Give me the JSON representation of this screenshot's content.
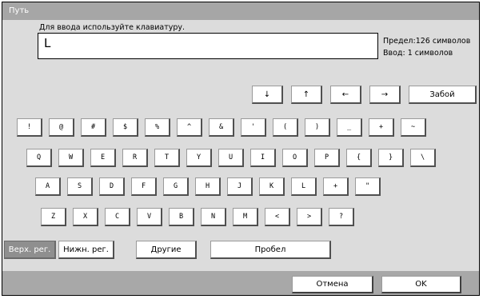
{
  "window": {
    "title": "Путь"
  },
  "prompt": {
    "instruction": "Для ввода используйте клавиатуру.",
    "value": "L"
  },
  "limits": {
    "max_label": "Предел:126 символов",
    "count_label": "Ввод: 1 символов"
  },
  "nav": {
    "down": "↓",
    "up": "↑",
    "left": "←",
    "right": "→",
    "backspace": "Забой"
  },
  "keys": {
    "row1": [
      "!",
      "@",
      "#",
      "$",
      "%",
      "^",
      "&",
      "'",
      "(",
      ")",
      "_",
      "+",
      "~"
    ],
    "row2": [
      "Q",
      "W",
      "E",
      "R",
      "T",
      "Y",
      "U",
      "I",
      "O",
      "P",
      "{",
      "}",
      "\\"
    ],
    "row3": [
      "A",
      "S",
      "D",
      "F",
      "G",
      "H",
      "J",
      "K",
      "L",
      "+",
      "\""
    ],
    "row4": [
      "Z",
      "X",
      "C",
      "V",
      "B",
      "N",
      "M",
      "<",
      ">",
      "?"
    ]
  },
  "modes": {
    "upper": "Верх. рег.",
    "lower": "Нижн. рег.",
    "other": "Другие",
    "space": "Пробел"
  },
  "footer": {
    "cancel": "Отмена",
    "ok": "OK"
  }
}
